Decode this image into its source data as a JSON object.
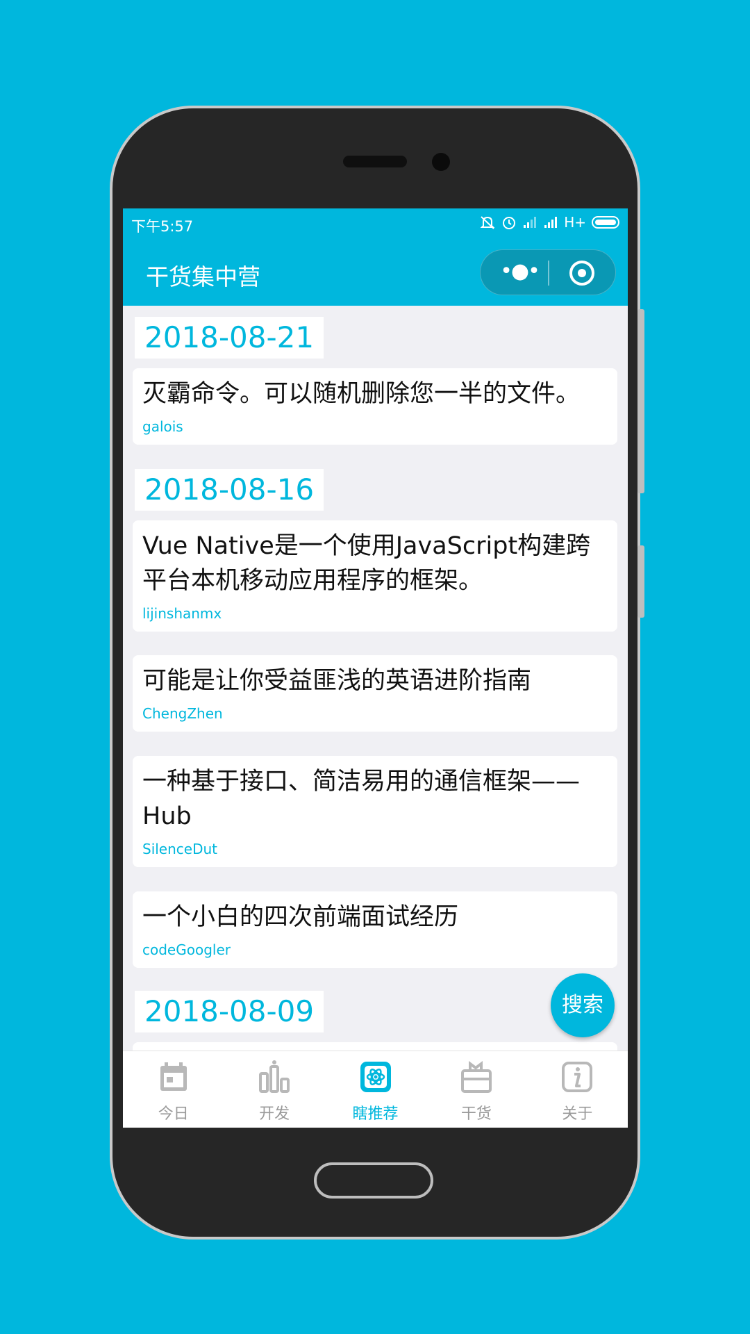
{
  "statusbar": {
    "time": "下午5:57",
    "network": "H+"
  },
  "navbar": {
    "title": "干货集中营",
    "more_label": "•●•"
  },
  "feed": [
    {
      "date": "2018-08-21",
      "items": [
        {
          "title": "灭霸命令。可以随机删除您一半的文件。",
          "author": "galois"
        }
      ]
    },
    {
      "date": "2018-08-16",
      "items": [
        {
          "title": "Vue Native是一个使用JavaScript构建跨平台本机移动应用程序的框架。",
          "author": "lijinshanmx"
        },
        {
          "title": "可能是让你受益匪浅的英语进阶指南",
          "author": "ChengZhen"
        },
        {
          "title": "一种基于接口、简洁易用的通信框架——Hub",
          "author": "SilenceDut"
        },
        {
          "title": "一个小白的四次前端面试经历",
          "author": "codeGoogler"
        }
      ]
    },
    {
      "date": "2018-08-09",
      "items": []
    }
  ],
  "fab": {
    "label": "搜索"
  },
  "tabbar": {
    "items": [
      {
        "label": "今日",
        "icon": "calendar-icon",
        "active": false
      },
      {
        "label": "开发",
        "icon": "bar-chart-icon",
        "active": false
      },
      {
        "label": "瞎推荐",
        "icon": "atom-icon",
        "active": true
      },
      {
        "label": "干货",
        "icon": "gift-box-icon",
        "active": false
      },
      {
        "label": "关于",
        "icon": "info-icon",
        "active": false
      }
    ]
  },
  "colors": {
    "accent": "#00B7DD",
    "inactive": "#9A9A9A",
    "background": "#F0F0F4"
  }
}
